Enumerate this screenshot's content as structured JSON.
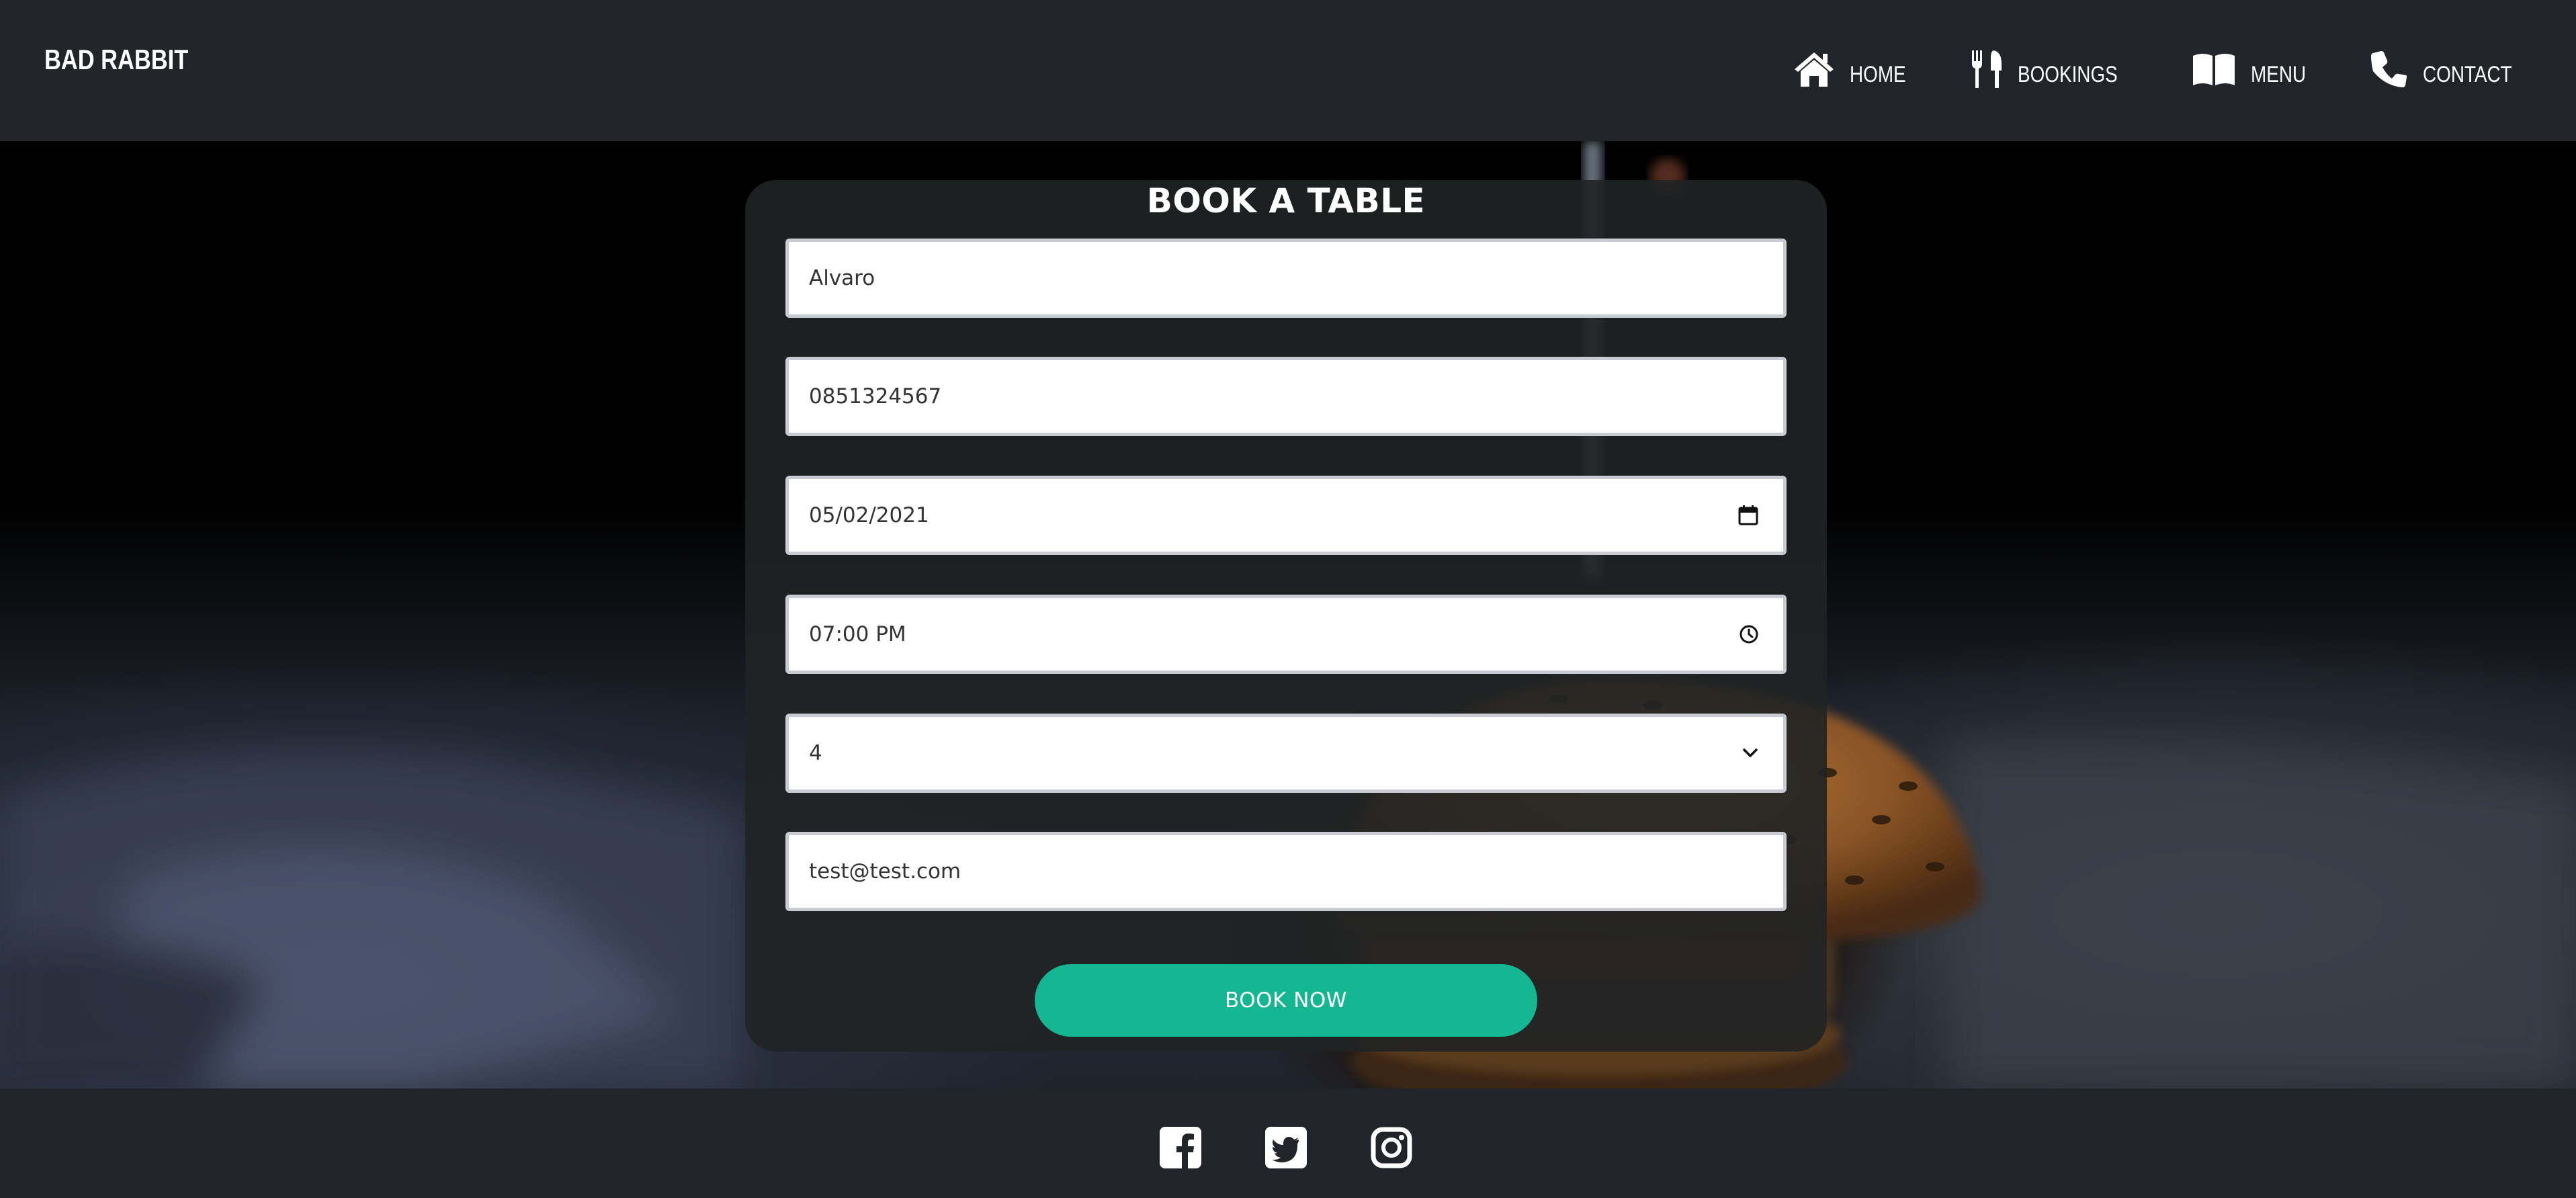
{
  "navbar": {
    "brand": "BAD RABBIT",
    "links": [
      {
        "label": "HOME",
        "icon": "home-icon"
      },
      {
        "label": "BOOKINGS",
        "icon": "utensils-icon"
      },
      {
        "label": "MENU",
        "icon": "book-open-icon"
      },
      {
        "label": "CONTACT",
        "icon": "phone-icon"
      }
    ]
  },
  "form": {
    "title": "BOOK A TABLE",
    "name_value": "Alvaro",
    "phone_value": "0851324567",
    "date_value": "05/02/2021",
    "time_value": "07:00 PM",
    "guests_value": "4",
    "email_value": "test@test.com",
    "submit_label": "BOOK NOW"
  },
  "footer": {
    "social": [
      "facebook-icon",
      "twitter-icon",
      "instagram-icon"
    ]
  },
  "colors": {
    "nav_bg": "#212529",
    "accent": "#14b791",
    "card_bg": "#202325"
  }
}
